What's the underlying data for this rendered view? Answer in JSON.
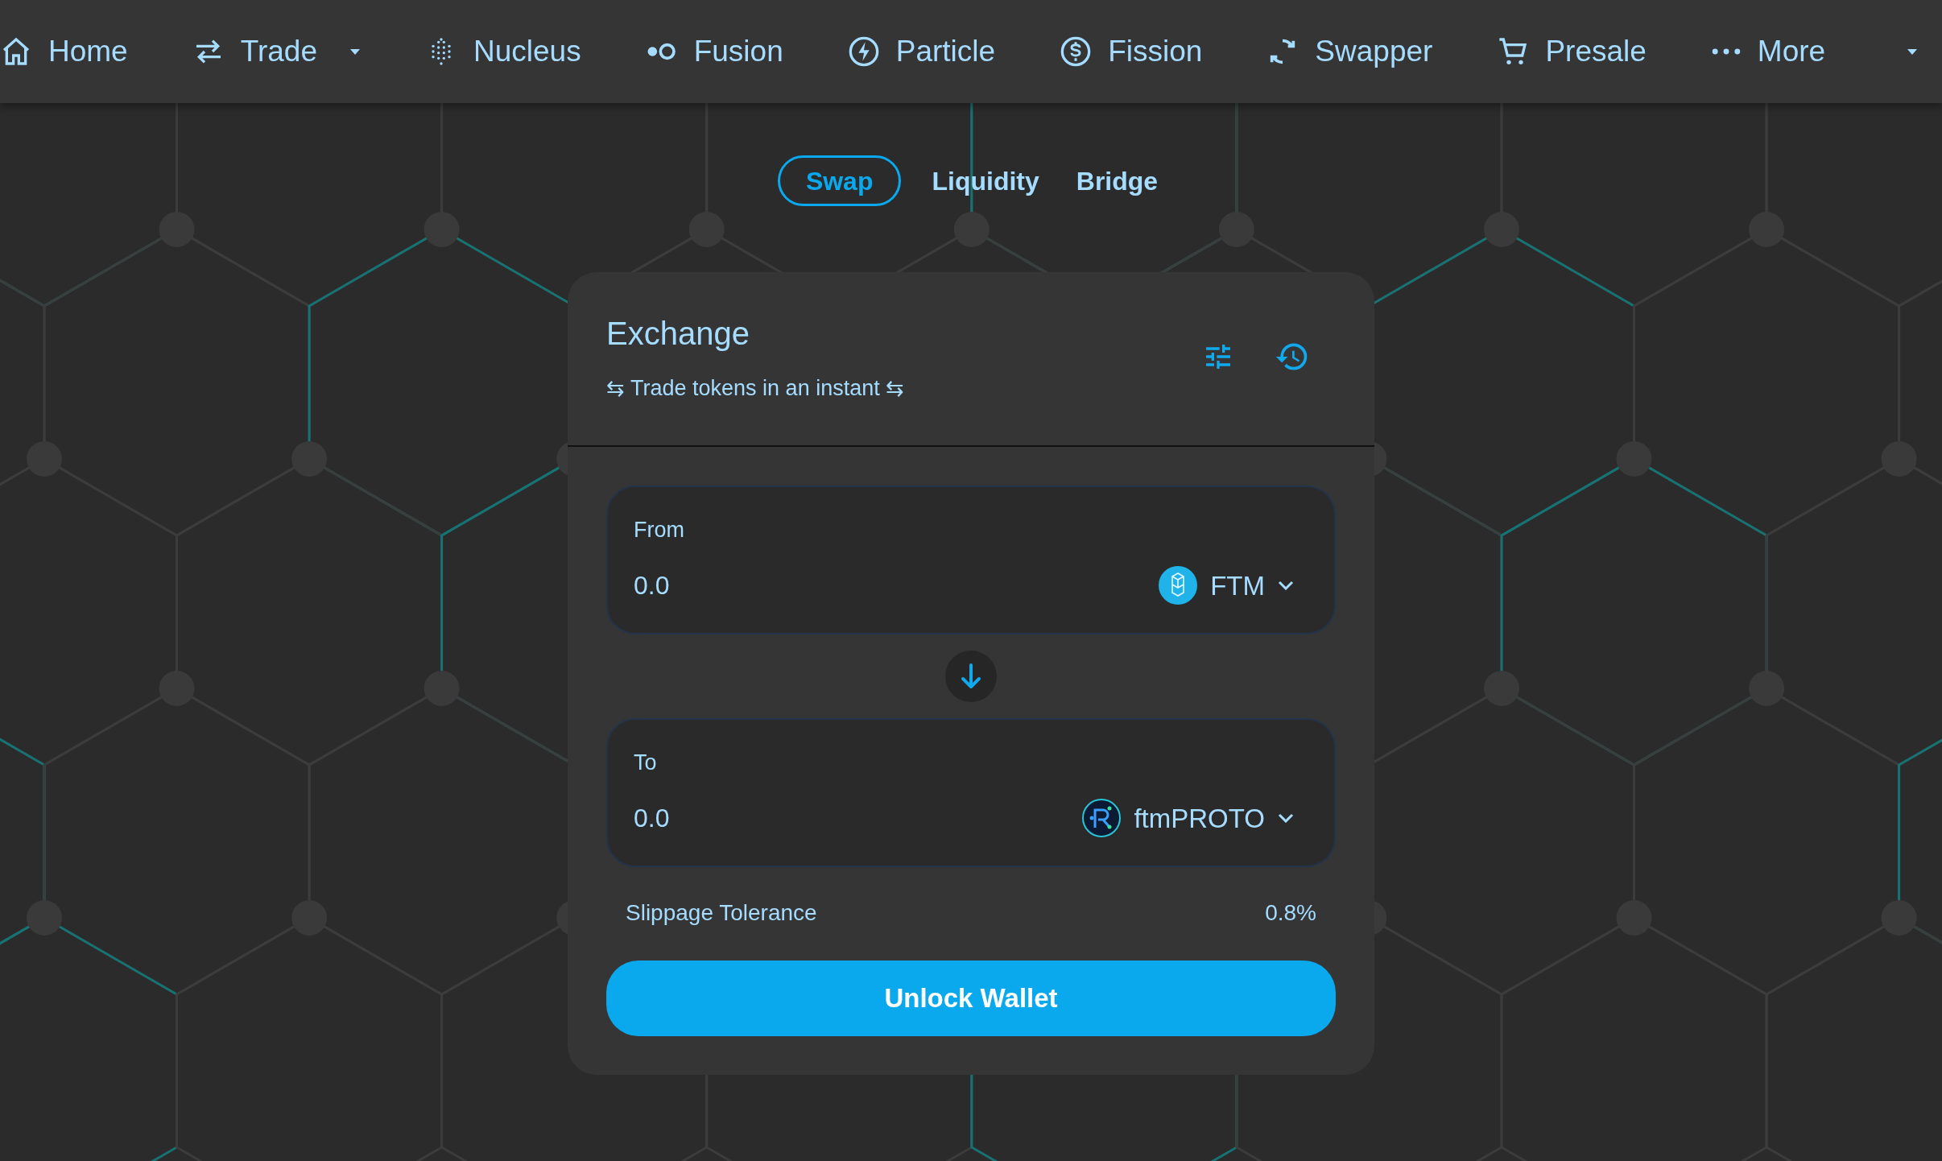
{
  "nav": {
    "items": [
      {
        "label": "Home",
        "dropdown": false
      },
      {
        "label": "Trade",
        "dropdown": true
      },
      {
        "label": "Nucleus",
        "dropdown": false
      },
      {
        "label": "Fusion",
        "dropdown": false
      },
      {
        "label": "Particle",
        "dropdown": false
      },
      {
        "label": "Fission",
        "dropdown": false
      },
      {
        "label": "Swapper",
        "dropdown": false
      },
      {
        "label": "Presale",
        "dropdown": false
      },
      {
        "label": "More",
        "dropdown": true
      }
    ]
  },
  "tabs": [
    {
      "label": "Swap",
      "selected": true
    },
    {
      "label": "Liquidity",
      "selected": false
    },
    {
      "label": "Bridge",
      "selected": false
    }
  ],
  "card": {
    "title": "Exchange",
    "subtitle": "⇆ Trade tokens in an instant ⇆",
    "from": {
      "label": "From",
      "value": "0.0",
      "token": "FTM"
    },
    "to": {
      "label": "To",
      "value": "0.0",
      "token": "ftmPROTO"
    },
    "slippage": {
      "label": "Slippage Tolerance",
      "value": "0.8%"
    },
    "button": "Unlock Wallet"
  }
}
